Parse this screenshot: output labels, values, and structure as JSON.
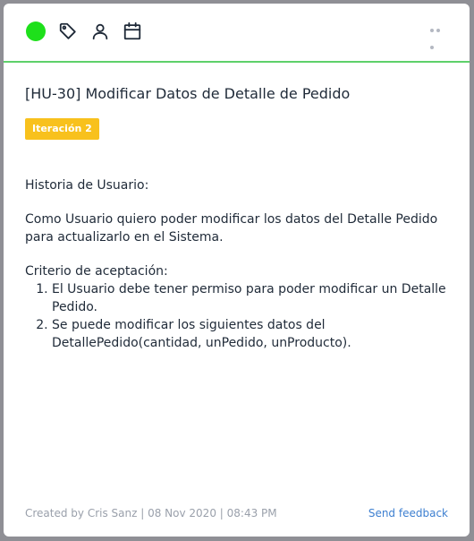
{
  "toolbar": {
    "status_color": "#1ee01b",
    "icons": [
      "tag-icon",
      "user-icon",
      "calendar-icon",
      "more-icon"
    ]
  },
  "task": {
    "title": "[HU-30] Modificar Datos de Detalle de Pedido",
    "badge": "Iteración 2",
    "badge_color": "#f8c11d"
  },
  "description": {
    "heading": "Historia de Usuario:",
    "story_line1": "Como Usuario quiero poder modificar los datos del Detalle Pedido",
    "story_line2": "para actualizarlo en el Sistema.",
    "criteria_heading": "Criterio de aceptación:",
    "criteria": [
      "El Usuario debe tener permiso para poder modificar un Detalle Pedido.",
      "Se puede modificar los siguientes datos del DetallePedido(cantidad, unPedido, unProducto)."
    ]
  },
  "footer": {
    "meta": "Created by Cris Sanz | 08 Nov 2020 | 08:43 PM",
    "feedback_label": "Send feedback"
  }
}
